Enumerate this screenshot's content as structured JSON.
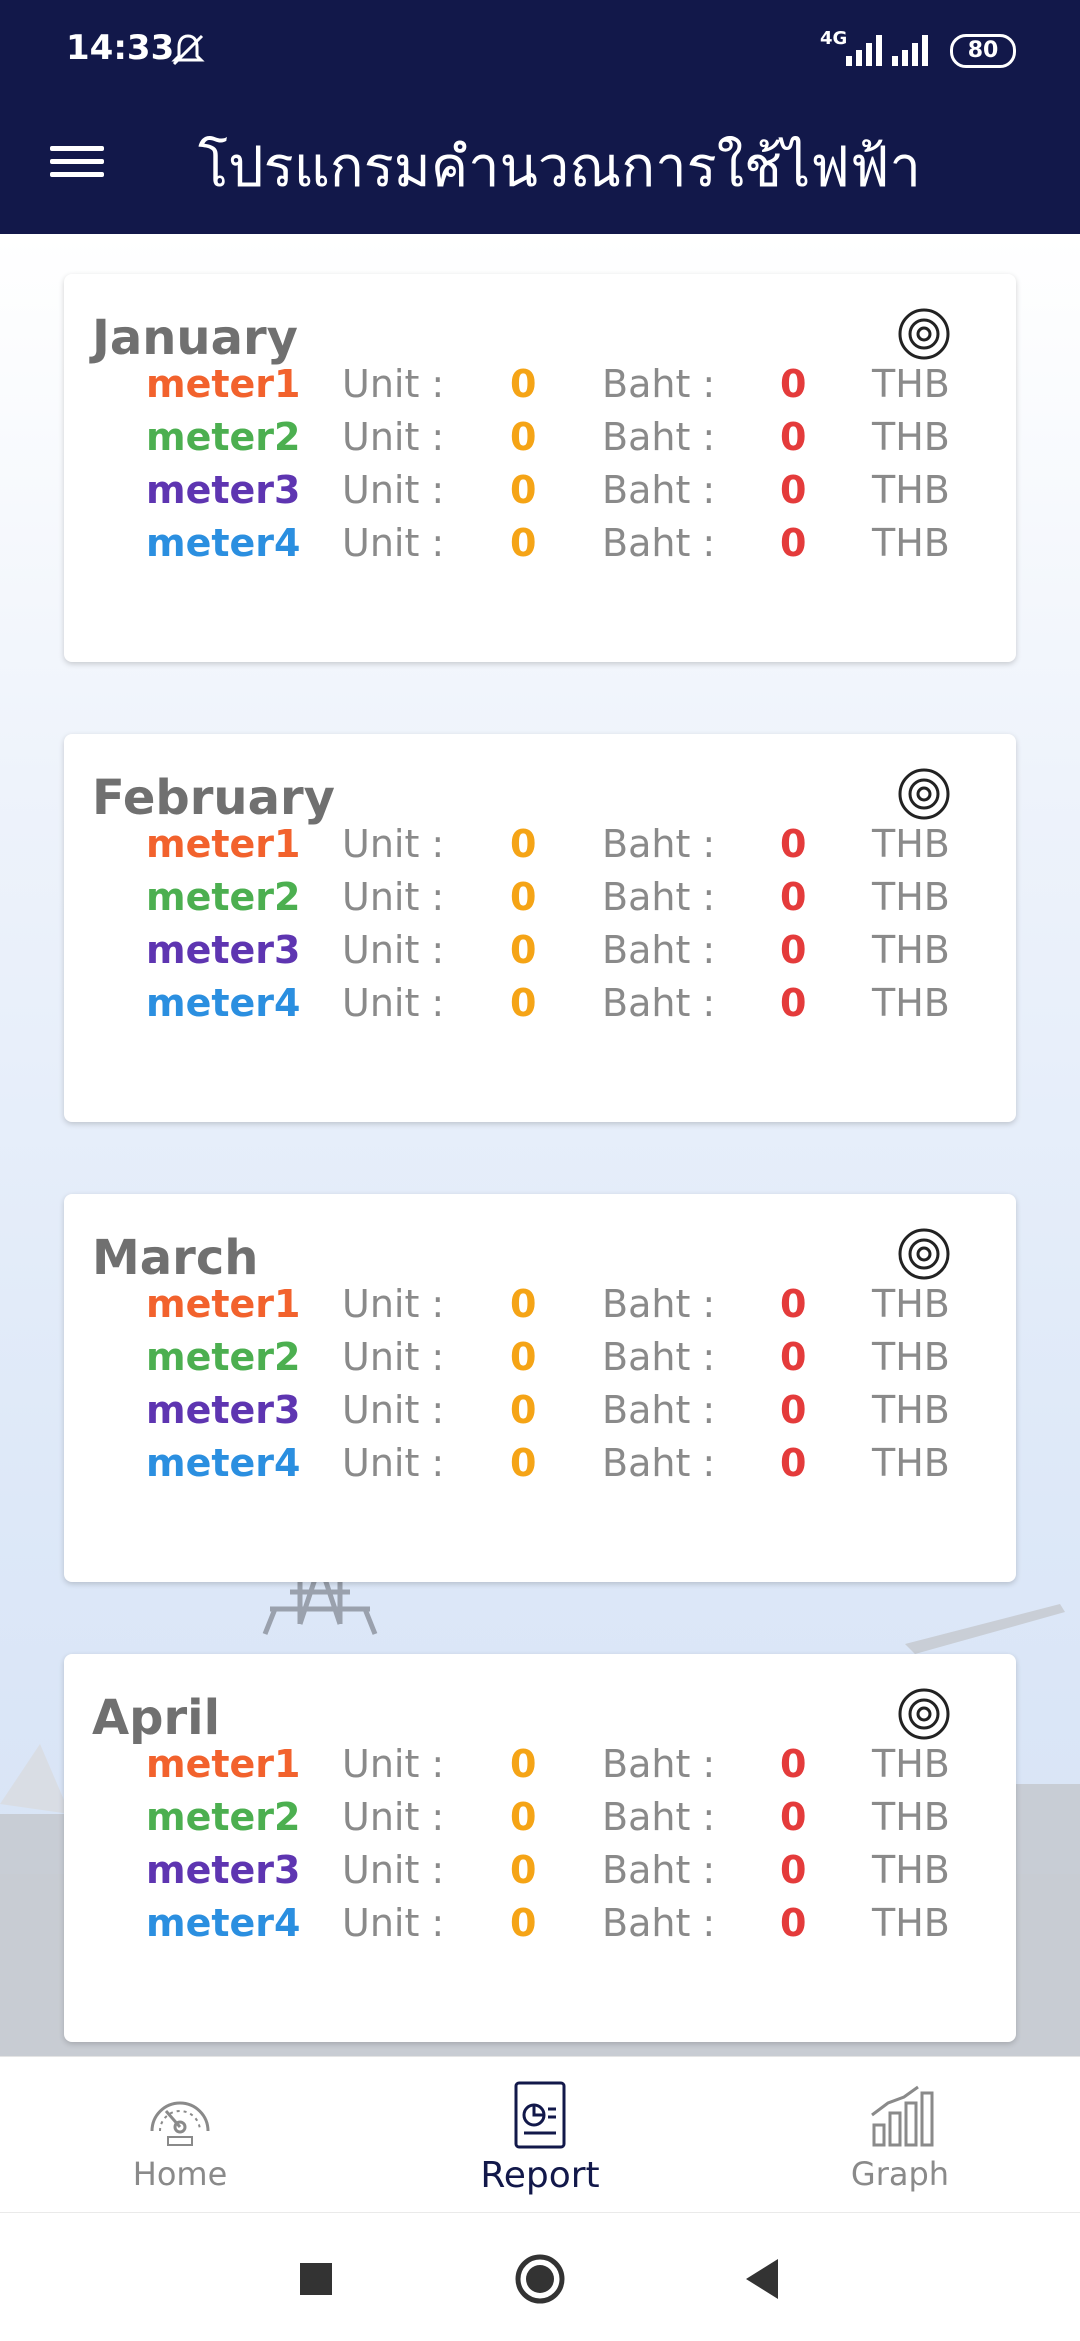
{
  "status_bar": {
    "time": "14:33",
    "network": "4G",
    "battery": "80",
    "icons": [
      "bell-muted-icon",
      "signal-icon",
      "signal-icon",
      "battery-icon"
    ]
  },
  "app_bar": {
    "title": "โปรแกรมคำนวณการใช้ไฟฟ้า",
    "menu_icon": "hamburger-menu-icon"
  },
  "labels": {
    "unit": "Unit :",
    "baht": "Baht :",
    "currency": "THB"
  },
  "meter_colors": {
    "meter1": "#f2622d",
    "meter2": "#4caf50",
    "meter3": "#5e35b1",
    "meter4": "#2b8fe0"
  },
  "months": [
    {
      "name": "January",
      "meters": [
        {
          "name": "meter1",
          "unit": "0",
          "baht": "0"
        },
        {
          "name": "meter2",
          "unit": "0",
          "baht": "0"
        },
        {
          "name": "meter3",
          "unit": "0",
          "baht": "0"
        },
        {
          "name": "meter4",
          "unit": "0",
          "baht": "0"
        }
      ]
    },
    {
      "name": "February",
      "meters": [
        {
          "name": "meter1",
          "unit": "0",
          "baht": "0"
        },
        {
          "name": "meter2",
          "unit": "0",
          "baht": "0"
        },
        {
          "name": "meter3",
          "unit": "0",
          "baht": "0"
        },
        {
          "name": "meter4",
          "unit": "0",
          "baht": "0"
        }
      ]
    },
    {
      "name": "March",
      "meters": [
        {
          "name": "meter1",
          "unit": "0",
          "baht": "0"
        },
        {
          "name": "meter2",
          "unit": "0",
          "baht": "0"
        },
        {
          "name": "meter3",
          "unit": "0",
          "baht": "0"
        },
        {
          "name": "meter4",
          "unit": "0",
          "baht": "0"
        }
      ]
    },
    {
      "name": "April",
      "meters": [
        {
          "name": "meter1",
          "unit": "0",
          "baht": "0"
        },
        {
          "name": "meter2",
          "unit": "0",
          "baht": "0"
        },
        {
          "name": "meter3",
          "unit": "0",
          "baht": "0"
        },
        {
          "name": "meter4",
          "unit": "0",
          "baht": "0"
        }
      ]
    }
  ],
  "bottom_nav": [
    {
      "label": "Home",
      "icon": "speedometer-icon",
      "active": false
    },
    {
      "label": "Report",
      "icon": "report-icon",
      "active": true
    },
    {
      "label": "Graph",
      "icon": "bar-chart-icon",
      "active": false
    }
  ],
  "system_nav": [
    "recents-square-icon",
    "home-circle-icon",
    "back-triangle-icon"
  ],
  "colors": {
    "app_bar": "#12184a",
    "unit_value": "#f5a416",
    "baht_value": "#e43b3b"
  }
}
